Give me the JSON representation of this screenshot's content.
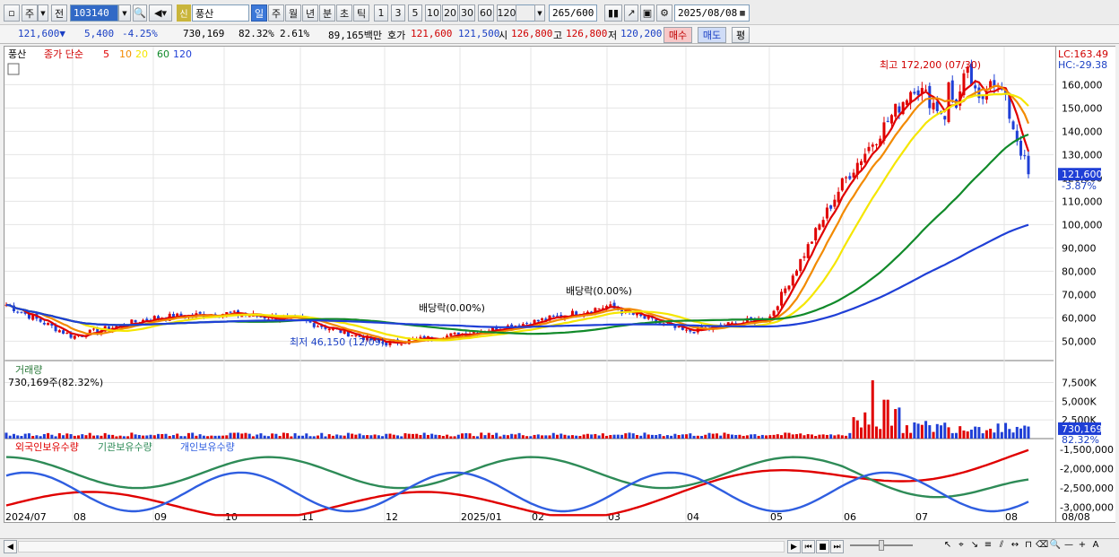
{
  "toolbar": {
    "type_label": "주",
    "prev_label": "전",
    "code": "103140",
    "sin_label": "신",
    "name": "풍산",
    "period_buttons": [
      "일",
      "주",
      "월",
      "년",
      "분",
      "초",
      "틱"
    ],
    "interval_buttons": [
      "1",
      "3",
      "5",
      "10",
      "20",
      "30",
      "60",
      "120"
    ],
    "count": "265",
    "count_total": "/600",
    "date": "2025/08/08"
  },
  "quote": {
    "price": "121,600",
    "arrow": "▼",
    "change": "5,400",
    "change_pct": "-4.25%",
    "volume": "730,169",
    "turnover_pct": "82.32%",
    "extra_pct": "2.61%",
    "amount": "89,165백만",
    "hoga_label": "호가",
    "ask": "121,600",
    "bid": "121,500",
    "open_label": "시",
    "open": "126,800",
    "high_label": "고",
    "high": "126,800",
    "low_label": "저",
    "low": "120,200",
    "buy_label": "매수",
    "sell_label": "매도",
    "eval_label": "평"
  },
  "price_panel": {
    "legend_name": "풍산",
    "legend_title": "종가 단순",
    "ma_labels": [
      "5",
      "10",
      "20",
      "60",
      "120"
    ],
    "ma_colors": [
      "#e00000",
      "#f28a00",
      "#f5e600",
      "#118a2a",
      "#1f3fd6"
    ],
    "lc": "LC:163.49",
    "hc": "HC:-29.38",
    "current_price": "121,600",
    "current_pct": "-3.87%",
    "high_annotation": "최고 172,200 (07/30)",
    "low_annotation": "최저 46,150 (12/09)",
    "dividend1": "배당락(0.00%)",
    "dividend2": "배당락(0.00%)",
    "y_ticks": [
      "160,000",
      "150,000",
      "140,000",
      "130,000",
      "120,000",
      "110,000",
      "100,000",
      "90,000",
      "80,000",
      "70,000",
      "60,000",
      "50,000"
    ]
  },
  "volume_panel": {
    "title": "거래량",
    "value": "730,169주(82.32%)",
    "y_ticks": [
      "7,500K",
      "5,000K",
      "2,500K"
    ],
    "current": "730,169",
    "current_pct": "82.32%"
  },
  "holding_panel": {
    "series": [
      "외국인보유수량",
      "기관보유수량",
      "개인보유수량"
    ],
    "colors": [
      "#e00000",
      "#2e8b57",
      "#2f5ee0"
    ],
    "y_ticks": [
      "-1,500,000",
      "-2,000,000",
      "-2,500,000",
      "-3,000,000"
    ]
  },
  "x_axis": {
    "labels": [
      "2024/07",
      "08",
      "09",
      "10",
      "11",
      "12",
      "2025/01",
      "02",
      "03",
      "04",
      "05",
      "06",
      "07",
      "08"
    ],
    "end_label": "08/08"
  },
  "colors": {
    "up": "#e00000",
    "down": "#1f3fd6",
    "accent": "#3c78d8"
  },
  "chart_data": {
    "type": "candlestick",
    "date_range": [
      "2024/07",
      "2025/08/08"
    ],
    "ylim": [
      44000,
      174000
    ],
    "monthly_close_approx": [
      {
        "x": "2024/07",
        "y": 66000
      },
      {
        "x": "08",
        "y": 52000
      },
      {
        "x": "09",
        "y": 60000
      },
      {
        "x": "10",
        "y": 62000
      },
      {
        "x": "11",
        "y": 59000
      },
      {
        "x": "12",
        "y": 49000
      },
      {
        "x": "2025/01",
        "y": 53000
      },
      {
        "x": "02",
        "y": 58000
      },
      {
        "x": "03",
        "y": 65000
      },
      {
        "x": "04",
        "y": 54000
      },
      {
        "x": "05",
        "y": 60000
      },
      {
        "x": "06",
        "y": 118000
      },
      {
        "x": "07",
        "y": 160000
      },
      {
        "x": "08",
        "y": 121600
      }
    ]
  }
}
